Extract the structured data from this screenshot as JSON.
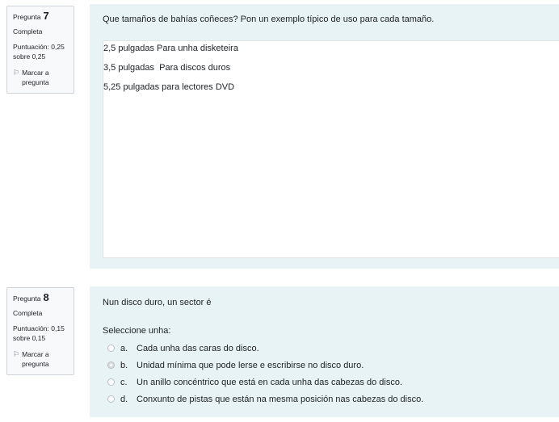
{
  "questions": [
    {
      "label": "Pregunta",
      "number": "7",
      "state": "Completa",
      "grade_line1": "Puntuación: 0,25",
      "grade_line2": "sobre 0,25",
      "flag_line1": "Marcar a",
      "flag_line2": "pregunta",
      "text": "Que tamaños de bahías coñeces? Pon un exemplo típico de uso para cada tamaño.",
      "answer_lines": [
        "2,5 pulgadas Para unha disketeira",
        "3,5 pulgadas  Para discos duros",
        "5,25 pulgadas para lectores DVD"
      ]
    },
    {
      "label": "Pregunta",
      "number": "8",
      "state": "Completa",
      "grade_line1": "Puntuación: 0,15",
      "grade_line2": "sobre 0,15",
      "flag_line1": "Marcar a",
      "flag_line2": "pregunta",
      "text": "Nun disco duro, un sector é",
      "prompt": "Seleccione unha:",
      "options": [
        {
          "letter": "a.",
          "text": "Cada unha das caras do disco.",
          "selected": false
        },
        {
          "letter": "b.",
          "text": "Unidad mínima que pode lerse e escribirse no disco duro.",
          "selected": true
        },
        {
          "letter": "c.",
          "text": "Un anillo concéntrico que está en cada unha das cabezas do disco.",
          "selected": false
        },
        {
          "letter": "d.",
          "text": "Conxunto de pistas que están na mesma posición nas cabezas do disco.",
          "selected": false
        }
      ]
    }
  ],
  "icons": {
    "flag": "flag-icon",
    "radio": "radio-icon"
  },
  "colors": {
    "content_bg": "#e7f3f5",
    "info_bg": "#f8f9fa",
    "border": "#cfd4da"
  }
}
